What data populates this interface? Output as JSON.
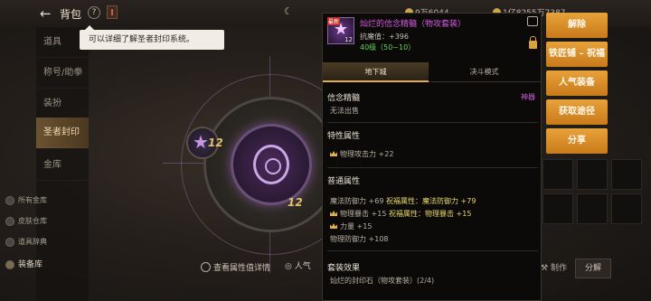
{
  "header": {
    "back_icon": "←",
    "title": "背包",
    "help_icon": "?",
    "currency_1": "9万6044",
    "currency_2": "1亿8255万7387",
    "count_prefix": "12"
  },
  "sidebar": {
    "items": [
      "道具",
      "称号/助拳",
      "装扮",
      "圣者封印",
      "金库"
    ],
    "active_index": 3,
    "sub_items": [
      "所有金库",
      "皮肤仓库",
      "道具辞典",
      "装备库"
    ]
  },
  "bubble": {
    "text": "可以详细了解圣者封印系统。"
  },
  "emblem": {
    "main_level": "12",
    "side_level": "12"
  },
  "bottom": {
    "view_attr": "查看属性值详情",
    "popular": "人气",
    "craft": "制作",
    "decompose": "分解"
  },
  "right_buttons": [
    "解除",
    "铁匠铺 – 祝福",
    "人气装备",
    "获取途径",
    "分享"
  ],
  "tooltip": {
    "badge": "最新",
    "item_level": "12",
    "name": "灿烂的信念精髓（物攻套装）",
    "resist": "抗魔值：+396",
    "level_req": "40级（50~10）",
    "tabs": [
      "地下城",
      "决斗模式"
    ],
    "section1_title": "信念精髓",
    "section1_rarity": "神器",
    "section1_line": "无法出售",
    "section2_title": "特性属性",
    "section2_lines": [
      "物理攻击力 +22"
    ],
    "section3_title": "普通属性",
    "section3_lines": [
      {
        "a": "魔法防御力 +69",
        "b": "祝福属性：魔法防御力 +79"
      },
      {
        "a": "物理暴击 +15",
        "b": "祝福属性：物理暴击 +15"
      },
      {
        "a": "力量 +15",
        "b": ""
      },
      {
        "a": "物理防御力 +108",
        "b": ""
      }
    ],
    "section4_title": "套装效果",
    "section4_line": "灿烂的封印石（物攻套装）(2/4)"
  },
  "colors": {
    "accent_orange": "#e8a23a",
    "epic_purple": "#d25ae0",
    "level_green": "#5fd45a"
  }
}
